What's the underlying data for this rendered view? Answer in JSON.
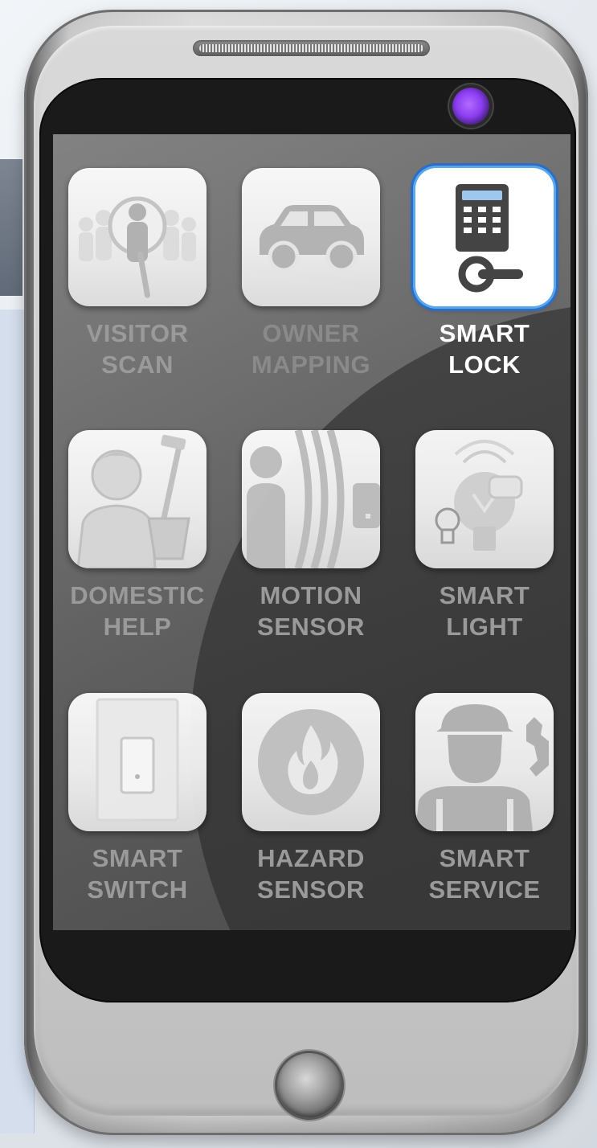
{
  "apps": [
    {
      "line1": "VISITOR",
      "line2": "SCAN",
      "icon": "visitor-search-icon"
    },
    {
      "line1": "OWNER",
      "line2": "MAPPING",
      "icon": "car-icon"
    },
    {
      "line1": "SMART",
      "line2": "LOCK",
      "icon": "keypad-lock-icon"
    },
    {
      "line1": "DOMESTIC",
      "line2": "HELP",
      "icon": "housekeeper-icon"
    },
    {
      "line1": "MOTION",
      "line2": "SENSOR",
      "icon": "motion-waves-icon"
    },
    {
      "line1": "SMART",
      "line2": "LIGHT",
      "icon": "lightbulb-icon"
    },
    {
      "line1": "SMART",
      "line2": "SWITCH",
      "icon": "wall-switch-icon"
    },
    {
      "line1": "HAZARD",
      "line2": "SENSOR",
      "icon": "flame-icon"
    },
    {
      "line1": "SMART",
      "line2": "SERVICE",
      "icon": "technician-icon"
    }
  ],
  "selected_app": "SMART LOCK",
  "nav": [
    {
      "icon": "back-icon"
    },
    {
      "icon": "menu-icon"
    },
    {
      "icon": "home-icon"
    },
    {
      "icon": "search-icon"
    }
  ],
  "colors": {
    "selection_ring": "#2b6fc4",
    "label_default": "#9a9a9a",
    "label_selected": "#ffffff",
    "camera_lens": "#8a3cf0"
  }
}
